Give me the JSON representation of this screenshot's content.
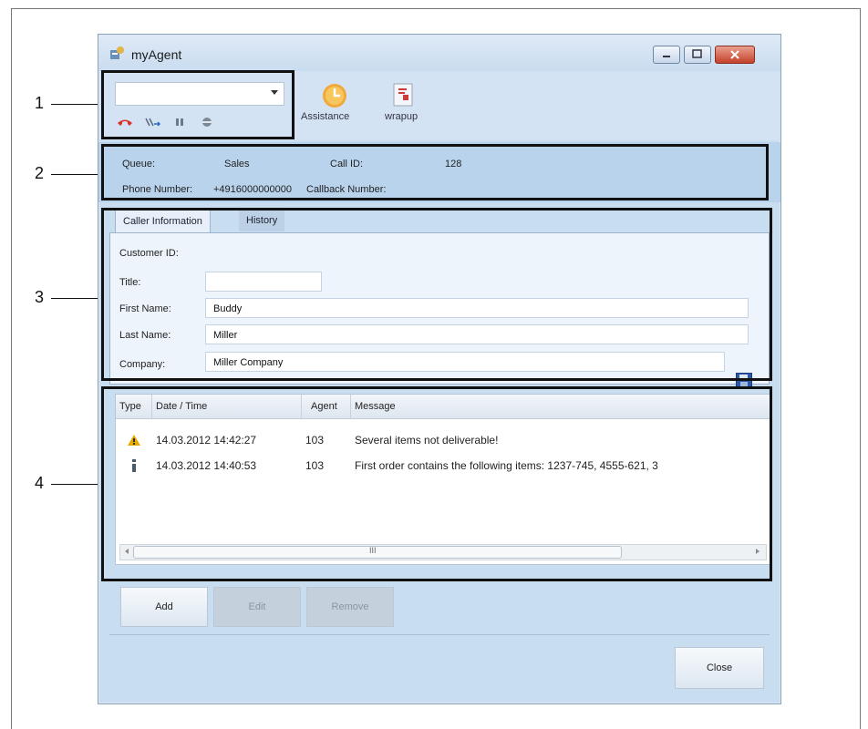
{
  "window": {
    "title": "myAgent"
  },
  "callouts": [
    "1",
    "2",
    "3",
    "4"
  ],
  "toolbar": {
    "combo_value": "",
    "assistance_label": "Assistance",
    "wrapup_label": "wrapup"
  },
  "call_info": {
    "queue_label": "Queue:",
    "queue_value": "Sales",
    "call_id_label": "Call ID:",
    "call_id_value": "128",
    "phone_label": "Phone Number:",
    "phone_value": "+4916000000000",
    "callback_label": "Callback Number:",
    "callback_value": ""
  },
  "tabs": [
    {
      "label": "Caller Information",
      "active": true
    },
    {
      "label": "History",
      "active": false
    }
  ],
  "caller_form": {
    "customer_id_label": "Customer ID:",
    "title_label": "Title:",
    "title_value": "",
    "first_name_label": "First Name:",
    "first_name_value": "Buddy",
    "last_name_label": "Last Name:",
    "last_name_value": "Miller",
    "company_label": "Company:",
    "company_value": "Miller Company"
  },
  "messages": {
    "columns": [
      "Type",
      "Date / Time",
      "Agent",
      "Message"
    ],
    "rows": [
      {
        "type_icon": "warning-icon",
        "datetime": "14.03.2012 14:42:27",
        "agent": "103",
        "message": "Several items not deliverable!"
      },
      {
        "type_icon": "info-icon",
        "datetime": "14.03.2012 14:40:53",
        "agent": "103",
        "message": "First order contains the following items: 1237-745, 4555-621, 3"
      }
    ],
    "scroll_grip": "III"
  },
  "actions": {
    "add": "Add",
    "edit": "Edit",
    "remove": "Remove",
    "close": "Close"
  },
  "colors": {
    "window_bg": "#c8ddf0",
    "info_bg": "#b9d3ec",
    "warning": "#e8a800",
    "hangup_red": "#d9332a"
  }
}
